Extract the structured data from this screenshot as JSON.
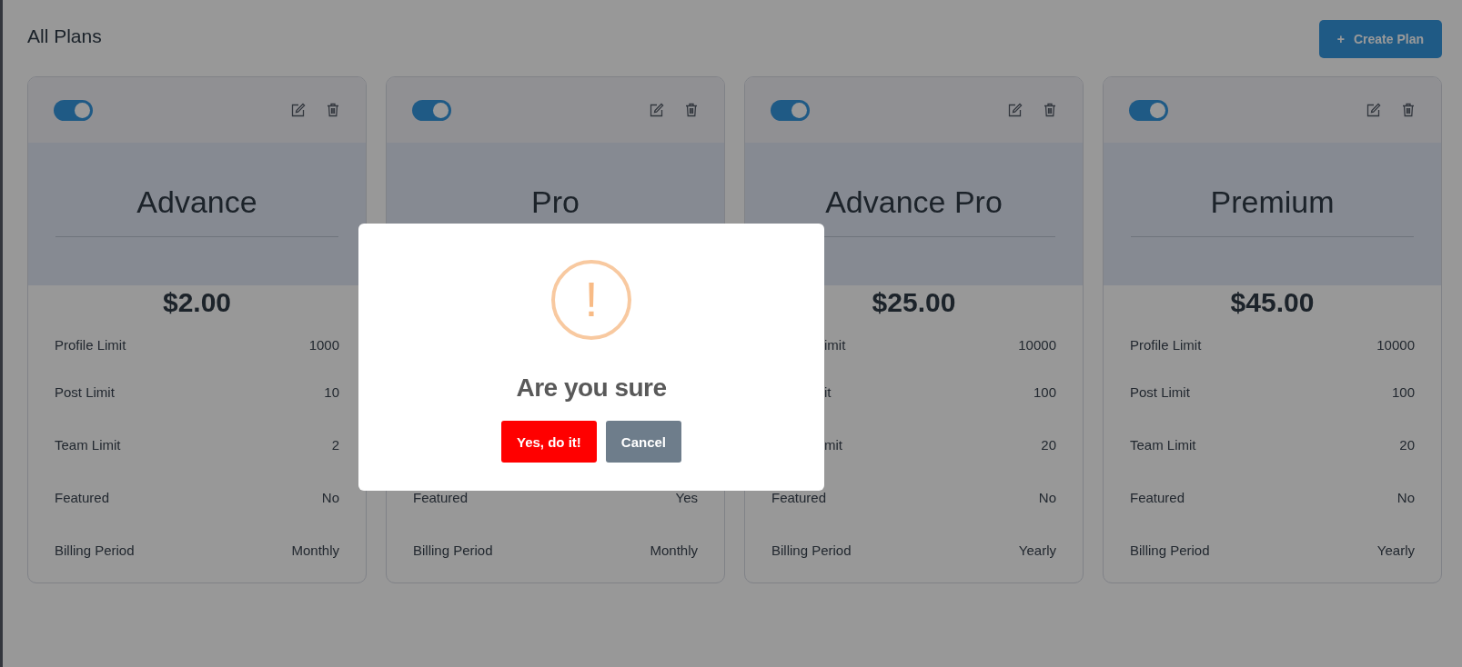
{
  "page": {
    "title": "All Plans",
    "create_button": {
      "icon": "+",
      "label": "Create Plan"
    }
  },
  "plans": [
    {
      "active": true,
      "title": "Advance",
      "price": "$2.00",
      "rows": [
        {
          "label": "Profile Limit",
          "value": "1000"
        },
        {
          "label": "Post Limit",
          "value": "10"
        },
        {
          "label": "Team Limit",
          "value": "2"
        },
        {
          "label": "Featured",
          "value": "No"
        },
        {
          "label": "Billing Period",
          "value": "Monthly"
        }
      ]
    },
    {
      "active": true,
      "title": "Pro",
      "rows": [
        {},
        {},
        {},
        {
          "label": "Featured",
          "value": "Yes"
        },
        {
          "label": "Billing Period",
          "value": "Monthly"
        }
      ]
    },
    {
      "active": true,
      "title": "Advance Pro",
      "price": "$25.00",
      "rows": [
        {
          "label": "imit",
          "kind": "cut",
          "value": "10000"
        },
        {
          "label": "it",
          "kind": "cut",
          "value": "100"
        },
        {
          "label": "mit",
          "kind": "cut",
          "value": "20"
        },
        {
          "label": "Featured",
          "value": "No"
        },
        {
          "label": "Billing Period",
          "value": "Yearly"
        }
      ]
    },
    {
      "active": true,
      "title": "Premium",
      "price": "$45.00",
      "rows": [
        {
          "label": "Profile Limit",
          "value": "10000"
        },
        {
          "label": "Post Limit",
          "value": "100"
        },
        {
          "label": "Team Limit",
          "value": "20"
        },
        {
          "label": "Featured",
          "value": "No"
        },
        {
          "label": "Billing Period",
          "value": "Yearly"
        }
      ]
    }
  ],
  "dialog": {
    "icon": "!",
    "title": "Are you sure",
    "buttons": [
      {
        "label": "Yes, do it!",
        "kind": "confirm"
      },
      {
        "label": "Cancel",
        "kind": "cancel"
      }
    ]
  }
}
